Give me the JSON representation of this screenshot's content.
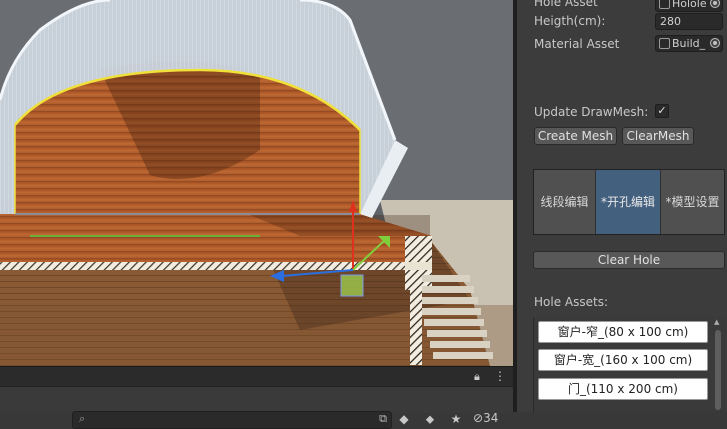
{
  "inspector": {
    "hole_asset_label": "Hole Asset",
    "hole_asset_value": "Holole",
    "height_label": "Heigth(cm):",
    "height_value": "280",
    "material_label": "Material Asset",
    "material_value": "Build_",
    "update_drawmesh_label": "Update DrawMesh:",
    "update_drawmesh_checked": true,
    "create_mesh_button": "Create Mesh",
    "clear_mesh_button": "ClearMesh",
    "tabs": [
      {
        "label": "线段编辑",
        "active": false
      },
      {
        "label": "*开孔编辑",
        "active": true
      },
      {
        "label": "*模型设置",
        "active": false
      }
    ],
    "clear_hole_button": "Clear Hole",
    "hole_assets_label": "Hole Assets:",
    "hole_assets": [
      "窗户-窄_(80 x 100 cm)",
      "窗户-宽_(160 x 100 cm)",
      "门_(110 x 200 cm)"
    ]
  },
  "scene_toolbar": {
    "search_placeholder": "",
    "hidden_count": "34"
  },
  "colors": {
    "inspector_bg": "#3c3c3c",
    "active_tab": "#44607f",
    "floor_wood": "#b4602c",
    "wall_glass": "#d4dce6",
    "gizmo_red": "#e0301e",
    "gizmo_green": "#7fd13b",
    "gizmo_blue": "#2a6ee0"
  }
}
